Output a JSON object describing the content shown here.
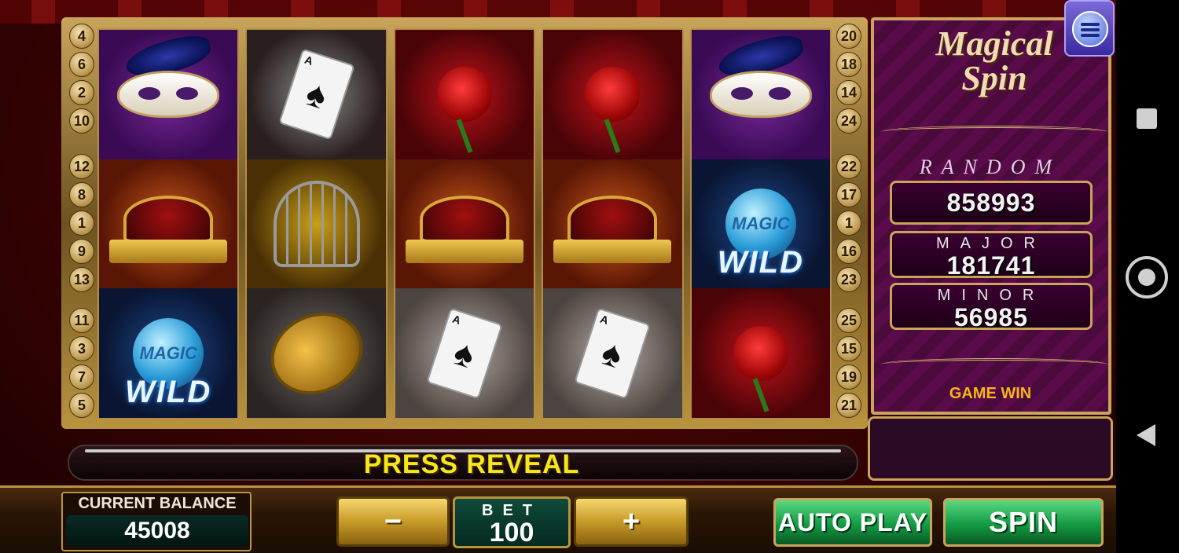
{
  "game": {
    "title_line1": "Magical",
    "title_line2": "Spin",
    "message": "PRESS REVEAL"
  },
  "paylines": {
    "left": [
      "4",
      "6",
      "2",
      "10",
      "12",
      "8",
      "1",
      "9",
      "13",
      "11",
      "3",
      "7",
      "5"
    ],
    "right": [
      "20",
      "18",
      "14",
      "24",
      "22",
      "17",
      "1",
      "16",
      "23",
      "25",
      "15",
      "19",
      "21"
    ]
  },
  "reels": [
    [
      "mask-icon",
      "crown-icon",
      "magic-wild-icon"
    ],
    [
      "ace-of-spades-icon",
      "birdcage-icon",
      "gold-coin-icon"
    ],
    [
      "rose-icon",
      "crown-icon",
      "ace-of-spades-icon"
    ],
    [
      "rose-icon",
      "crown-icon",
      "ace-of-spades-icon"
    ],
    [
      "mask-icon",
      "magic-wild-icon",
      "rose-icon"
    ]
  ],
  "symbols": {
    "magic_text": "MAGIC",
    "wild_text": "WILD",
    "card_index": "A"
  },
  "jackpots": {
    "random_label": "RANDOM",
    "random_value": "858993",
    "major_label": "MAJOR",
    "major_value": "181741",
    "minor_label": "MINOR",
    "minor_value": "56985",
    "game_win_label": "GAME WIN"
  },
  "controls": {
    "balance_label": "CURRENT BALANCE",
    "balance_value": "45008",
    "minus_label": "−",
    "plus_label": "+",
    "bet_label": "BET",
    "bet_value": "100",
    "auto_play_label": "AUTO PLAY",
    "spin_label": "SPIN"
  },
  "colors": {
    "accent_gold": "#c9a45a",
    "message_yellow": "#f7e71a",
    "game_win_orange": "#f5b41a",
    "spin_green": "#139a44",
    "panel_purple": "#5a0b4a"
  }
}
